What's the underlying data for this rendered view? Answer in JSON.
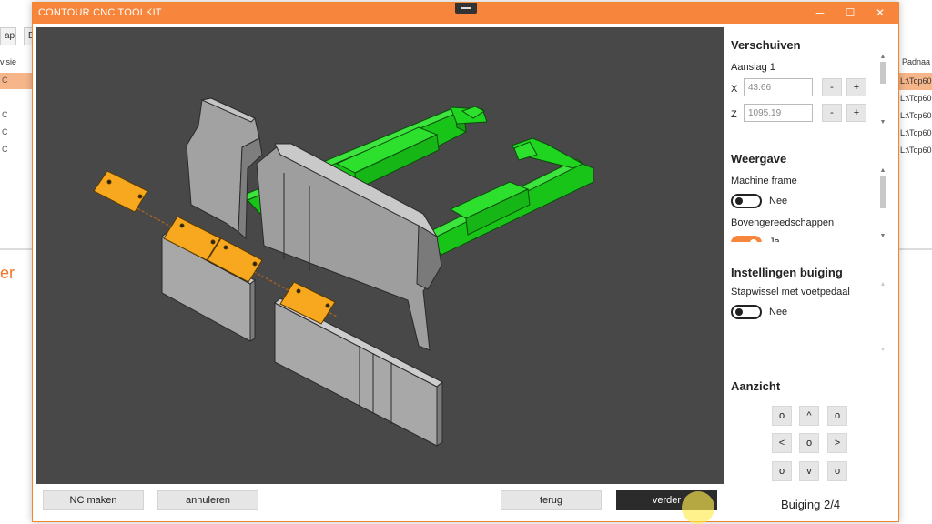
{
  "background_app": {
    "tabs": [
      "ap",
      "B"
    ],
    "left_column_header": "visie",
    "right_column_header": "Padnaa",
    "right_rows": [
      "L:\\Top60",
      "L:\\Top60",
      "L:\\Top60",
      "L:\\Top60",
      "L:\\Top60"
    ],
    "left_rows": [
      "C",
      "C",
      "C",
      "C",
      "C"
    ],
    "orange_text": "er"
  },
  "window": {
    "title": "CONTOUR CNC TOOLKIT",
    "minimize": "─",
    "maximize": "☐",
    "close": "✕"
  },
  "panel": {
    "shift": {
      "title": "Verschuiven",
      "stop_label": "Aanslag 1",
      "x_label": "X",
      "x_value": "43.66",
      "z_label": "Z",
      "z_value": "1095.19",
      "minus": "-",
      "plus": "+"
    },
    "display": {
      "title": "Weergave",
      "machine_frame_label": "Machine frame",
      "machine_frame_value": "Nee",
      "upper_tools_label": "Bovengereedschappen",
      "upper_tools_value": "Ja"
    },
    "bending": {
      "title": "Instellingen buiging",
      "pedal_label": "Stapwissel met voetpedaal",
      "pedal_value": "Nee"
    },
    "view": {
      "title": "Aanzicht",
      "buttons": [
        "o",
        "^",
        "o",
        "<",
        "o",
        ">",
        "o",
        "v",
        "o"
      ]
    },
    "status": "Buiging 2/4"
  },
  "buttons": {
    "nc": "NC maken",
    "cancel": "annuleren",
    "back": "terug",
    "next": "verder"
  },
  "colors": {
    "accent": "#f7853b",
    "viewport_bg": "#484848",
    "tool_grey": "#9a9a9a",
    "clamp_green": "#1fd51f",
    "finger_orange": "#f7a81e"
  }
}
